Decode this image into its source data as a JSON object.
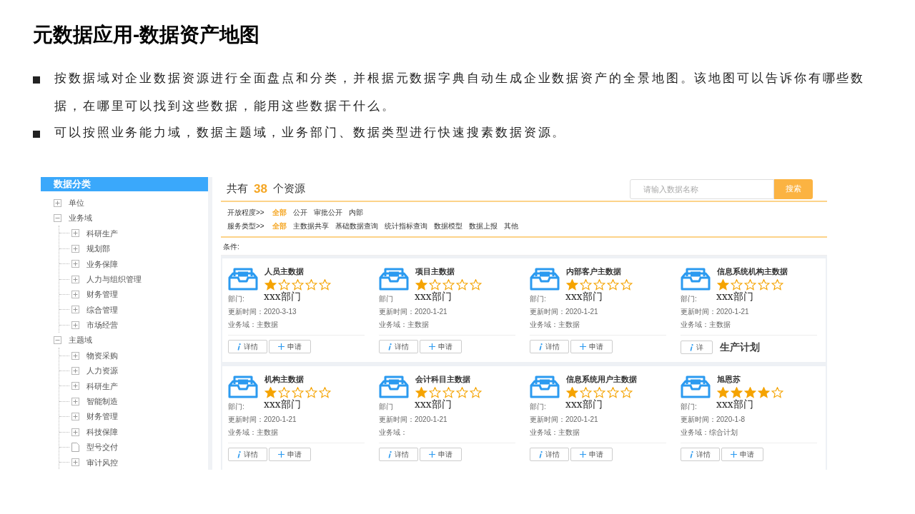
{
  "title": "元数据应用-数据资产地图",
  "bullets": [
    "按数据域对企业数据资源进行全面盘点和分类，并根据元数据字典自动生成企业数据资产的全景地图。该地图可以告诉你有哪些数据，在哪里可以找到这些数据，能用这些数据干什么。",
    "可以按照业务能力域，数据主题域，业务部门、数据类型进行快速搜素数据资源。"
  ],
  "sidebar": {
    "title": "数据分类",
    "tree": [
      {
        "label": "单位",
        "kind": "folder",
        "expanded": false
      },
      {
        "label": "业务域",
        "kind": "folder",
        "expanded": true,
        "children": [
          {
            "label": "科研生产",
            "kind": "folder",
            "expanded": false
          },
          {
            "label": "规划部",
            "kind": "folder",
            "expanded": false
          },
          {
            "label": "业务保障",
            "kind": "folder",
            "expanded": false
          },
          {
            "label": "人力与组织管理",
            "kind": "folder",
            "expanded": false
          },
          {
            "label": "财务管理",
            "kind": "folder",
            "expanded": false
          },
          {
            "label": "综合管理",
            "kind": "folder",
            "expanded": false
          },
          {
            "label": "市场经营",
            "kind": "folder",
            "expanded": false
          }
        ]
      },
      {
        "label": "主题域",
        "kind": "folder",
        "expanded": true,
        "children": [
          {
            "label": "物资采购",
            "kind": "folder",
            "expanded": false
          },
          {
            "label": "人力资源",
            "kind": "folder",
            "expanded": false
          },
          {
            "label": "科研生产",
            "kind": "folder",
            "expanded": false
          },
          {
            "label": "智能制造",
            "kind": "folder",
            "expanded": false
          },
          {
            "label": "财务管理",
            "kind": "folder",
            "expanded": false
          },
          {
            "label": "科技保障",
            "kind": "folder",
            "expanded": false
          },
          {
            "label": "型号交付",
            "kind": "file"
          },
          {
            "label": "审计风控",
            "kind": "folder",
            "expanded": false
          }
        ]
      }
    ]
  },
  "summary": {
    "prefix": "共有",
    "count": "38",
    "suffix": "个资源"
  },
  "search": {
    "placeholder": "请输入数据名称",
    "button": "搜索"
  },
  "filters": [
    {
      "label": "开放程度>>",
      "options": [
        {
          "label": "全部",
          "selected": true
        },
        {
          "label": "公开",
          "selected": false
        },
        {
          "label": "审批公开",
          "selected": false
        },
        {
          "label": "内部",
          "selected": false
        }
      ]
    },
    {
      "label": "服务类型>>",
      "options": [
        {
          "label": "全部",
          "selected": true
        },
        {
          "label": "主数据共享",
          "selected": false
        },
        {
          "label": "基础数据查询",
          "selected": false
        },
        {
          "label": "统计指标查询",
          "selected": false
        },
        {
          "label": "数据模型",
          "selected": false
        },
        {
          "label": "数据上报",
          "selected": false
        },
        {
          "label": "其他",
          "selected": false
        }
      ]
    }
  ],
  "condition_label": "条件:",
  "cards": [
    {
      "name": "人员主数据",
      "stars": 1,
      "dept_label": "部门:",
      "dept": "xxx部门",
      "updated": "更新时间：2020-3-13",
      "domain": "业务域：主数据",
      "buttons": [
        {
          "kind": "detail",
          "label": "详情"
        },
        {
          "kind": "apply",
          "label": "申请"
        }
      ]
    },
    {
      "name": "项目主数据",
      "stars": 1,
      "dept_label": "部门",
      "dept": "xxx部门",
      "updated": "更新时间：2020-1-21",
      "domain": "业务域：主数据",
      "buttons": [
        {
          "kind": "detail",
          "label": "详情"
        },
        {
          "kind": "apply",
          "label": "申请"
        }
      ]
    },
    {
      "name": "内部客户主数据",
      "stars": 1,
      "dept_label": "部门:",
      "dept": "xxx部门",
      "updated": "更新时间：2020-1-21",
      "domain": "业务域：主数据",
      "buttons": [
        {
          "kind": "detail",
          "label": "详情"
        },
        {
          "kind": "apply",
          "label": "申请"
        }
      ]
    },
    {
      "name": "信息系统机构主数据",
      "stars": 1,
      "dept_label": "部门:",
      "dept": "xxx部门",
      "updated": "更新时间：2020-1-21",
      "domain": "业务域：主数据",
      "buttons": [
        {
          "kind": "detail",
          "label": "详"
        }
      ],
      "overlay": "生产计划"
    },
    {
      "name": "机构主数据",
      "stars": 1,
      "dept_label": "部门:",
      "dept": "xxx部门",
      "updated": "更新时间：2020-1-21",
      "domain": "业务域：主数据",
      "buttons": [
        {
          "kind": "detail",
          "label": "详情"
        },
        {
          "kind": "apply",
          "label": "申请"
        }
      ]
    },
    {
      "name": "会计科目主数据",
      "stars": 1,
      "dept_label": "部门",
      "dept": "xxx部门",
      "updated": "更新时间：2020-1-21",
      "domain": "业务域：",
      "buttons": [
        {
          "kind": "detail",
          "label": "详情"
        },
        {
          "kind": "apply",
          "label": "申请"
        }
      ]
    },
    {
      "name": "信息系统用户主数据",
      "stars": 1,
      "dept_label": "部门:",
      "dept": "xxx部门",
      "updated": "更新时间：2020-1-21",
      "domain": "业务域：主数据",
      "buttons": [
        {
          "kind": "detail",
          "label": "详情"
        },
        {
          "kind": "apply",
          "label": "申请"
        }
      ]
    },
    {
      "name": "旭恩苏",
      "stars": 4,
      "dept_label": "部门:",
      "dept": "xxx部门",
      "updated": "更新时间：2020-1-8",
      "domain": "业务域：综合计划",
      "buttons": [
        {
          "kind": "detail",
          "label": "详情"
        },
        {
          "kind": "apply",
          "label": "申请"
        }
      ]
    }
  ]
}
